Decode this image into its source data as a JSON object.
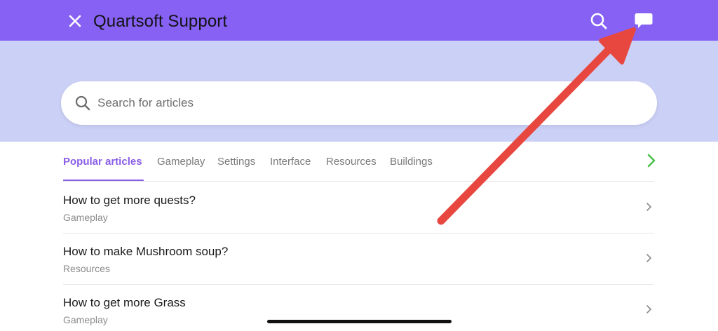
{
  "header": {
    "title": "Quartsoft Support",
    "close_icon": "close-icon",
    "search_icon": "search-icon",
    "chat_icon": "chat-bubble-icon",
    "background": "#8661f4"
  },
  "search": {
    "placeholder": "Search for articles",
    "value": ""
  },
  "tabs": [
    {
      "label": "Popular articles",
      "active": true
    },
    {
      "label": "Gameplay",
      "active": false
    },
    {
      "label": "Settings",
      "active": false
    },
    {
      "label": "Interface",
      "active": false
    },
    {
      "label": "Resources",
      "active": false
    },
    {
      "label": "Buildings",
      "active": false
    }
  ],
  "articles": [
    {
      "title": "How to get more quests?",
      "category": "Gameplay"
    },
    {
      "title": "How to make Mushroom soup?",
      "category": "Resources"
    },
    {
      "title": "How to get more Grass",
      "category": "Gameplay"
    }
  ],
  "colors": {
    "accent": "#8a5ee8",
    "band": "#cbd0f6",
    "tabs_next_arrow": "#4cc14c",
    "annotation_arrow": "#e7473e"
  }
}
